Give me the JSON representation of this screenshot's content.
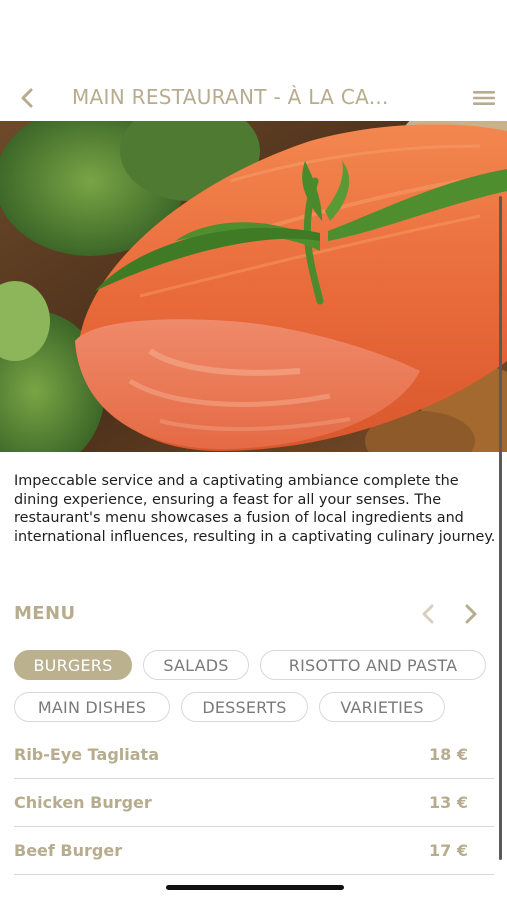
{
  "header": {
    "title": "MAIN RESTAURANT - À LA CA..."
  },
  "description": "Impeccable service and a captivating ambiance complete the dining experience, ensuring a feast for all your senses. The restaurant's menu showcases a fusion of local ingredients and international influences, resulting in a captivating culinary journey.",
  "menu": {
    "label": "MENU",
    "categories": [
      {
        "label": "BURGERS",
        "active": true
      },
      {
        "label": "SALADS",
        "active": false
      },
      {
        "label": "RISOTTO AND PASTA",
        "active": false
      },
      {
        "label": "MAIN DISHES",
        "active": false
      },
      {
        "label": "DESSERTS",
        "active": false
      },
      {
        "label": "VARIETIES",
        "active": false
      }
    ],
    "items": [
      {
        "name": "Rib-Eye Tagliata",
        "price": "18 €"
      },
      {
        "name": "Chicken Burger",
        "price": "13 €"
      },
      {
        "name": "Beef Burger",
        "price": "17 €"
      }
    ]
  },
  "colors": {
    "accent": "#b8ac8e",
    "chip_active": "#bcb18f"
  },
  "icons": {
    "back": "chevron-left-icon",
    "menu": "hamburger-menu-icon",
    "prev": "chevron-left-icon",
    "next": "chevron-right-icon"
  }
}
